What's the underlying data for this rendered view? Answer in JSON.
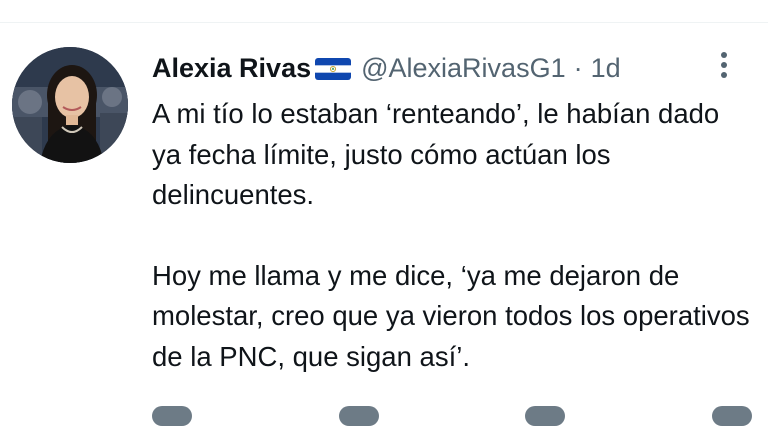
{
  "tweet": {
    "author": {
      "display_name": "Alexia Rivas",
      "flag": "el-salvador-flag-icon",
      "handle": "@AlexiaRivasG1"
    },
    "separator": "·",
    "time": "1d",
    "paragraphs": [
      "A mi tío lo estaban ‘renteando’, le habían dado ya fecha límite, justo cómo actúan los delincuentes.",
      "Hoy me llama y me dice, ‘ya me dejaron de molestar, creo que ya vieron todos los operativos de la PNC, que sigan así’."
    ],
    "more_icon": "more-options-icon"
  },
  "colors": {
    "text": "#0f1419",
    "muted": "#536471",
    "flag_blue": "#0f47af",
    "flag_white": "#ffffff"
  }
}
